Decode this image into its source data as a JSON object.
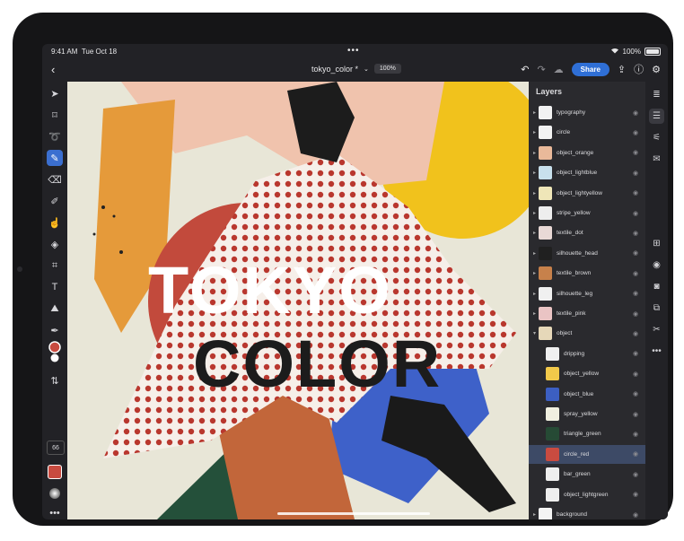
{
  "status_bar": {
    "time": "9:41 AM",
    "date": "Tue Oct 18",
    "battery": "100%"
  },
  "top_bar": {
    "doc_title": "tokyo_color *",
    "zoom": "100%",
    "share_label": "Share"
  },
  "left_tools": [
    "select-tool",
    "transform-tool",
    "lasso-tool",
    "brush-tool",
    "eraser-tool",
    "healing-tool",
    "smudge-tool",
    "fill-tool",
    "crop-tool",
    "type-tool",
    "place-image-tool",
    "eyedropper-tool",
    "color-swatch",
    "swap-tool"
  ],
  "brush_size": "66",
  "layers_panel": {
    "header": "Layers",
    "layers": [
      {
        "name": "typography",
        "expanded": false,
        "child": false,
        "thumb": "#f2f2f2"
      },
      {
        "name": "circle",
        "expanded": false,
        "child": false,
        "thumb": "#f2f2f2"
      },
      {
        "name": "object_orange",
        "expanded": false,
        "child": false,
        "thumb": "#e9b99a"
      },
      {
        "name": "object_lightblue",
        "expanded": false,
        "child": false,
        "thumb": "#c8e0ec"
      },
      {
        "name": "object_lightyellow",
        "expanded": false,
        "child": false,
        "thumb": "#efe6b8"
      },
      {
        "name": "stripe_yellow",
        "expanded": false,
        "child": false,
        "thumb": "#eeeeee"
      },
      {
        "name": "textile_dot",
        "expanded": false,
        "child": false,
        "thumb": "#e9d9d6"
      },
      {
        "name": "silhouette_head",
        "expanded": false,
        "child": false,
        "thumb": "#202020"
      },
      {
        "name": "textile_brown",
        "expanded": false,
        "child": false,
        "thumb": "#c7814b"
      },
      {
        "name": "silhouette_leg",
        "expanded": false,
        "child": false,
        "thumb": "#f0f0f0"
      },
      {
        "name": "textile_pink",
        "expanded": false,
        "child": false,
        "thumb": "#eac4c4"
      },
      {
        "name": "object",
        "expanded": true,
        "child": false,
        "thumb": "#e6d8b9"
      },
      {
        "name": "dripping",
        "expanded": false,
        "child": true,
        "thumb": "#f0f0f0"
      },
      {
        "name": "object_yellow",
        "expanded": false,
        "child": true,
        "thumb": "#f2c94a"
      },
      {
        "name": "object_blue",
        "expanded": false,
        "child": true,
        "thumb": "#3c5fc2"
      },
      {
        "name": "spray_yellow",
        "expanded": false,
        "child": true,
        "thumb": "#f0efe0"
      },
      {
        "name": "triangle_green",
        "expanded": false,
        "child": true,
        "thumb": "#264a35"
      },
      {
        "name": "circle_red",
        "expanded": false,
        "child": true,
        "thumb": "#c94b40",
        "selected": true
      },
      {
        "name": "bar_green",
        "expanded": false,
        "child": true,
        "thumb": "#eeeeee"
      },
      {
        "name": "object_lightgreen",
        "expanded": false,
        "child": true,
        "thumb": "#eeeeee"
      },
      {
        "name": "background",
        "expanded": false,
        "child": false,
        "thumb": "#f4f4f4"
      }
    ]
  },
  "artwork": {
    "line1": "TOKYO",
    "line2": "COLOR"
  },
  "colors": {
    "accent": "#2f6fd6",
    "primary_swatch": "#c94b40",
    "secondary_swatch": "#ffffff"
  }
}
